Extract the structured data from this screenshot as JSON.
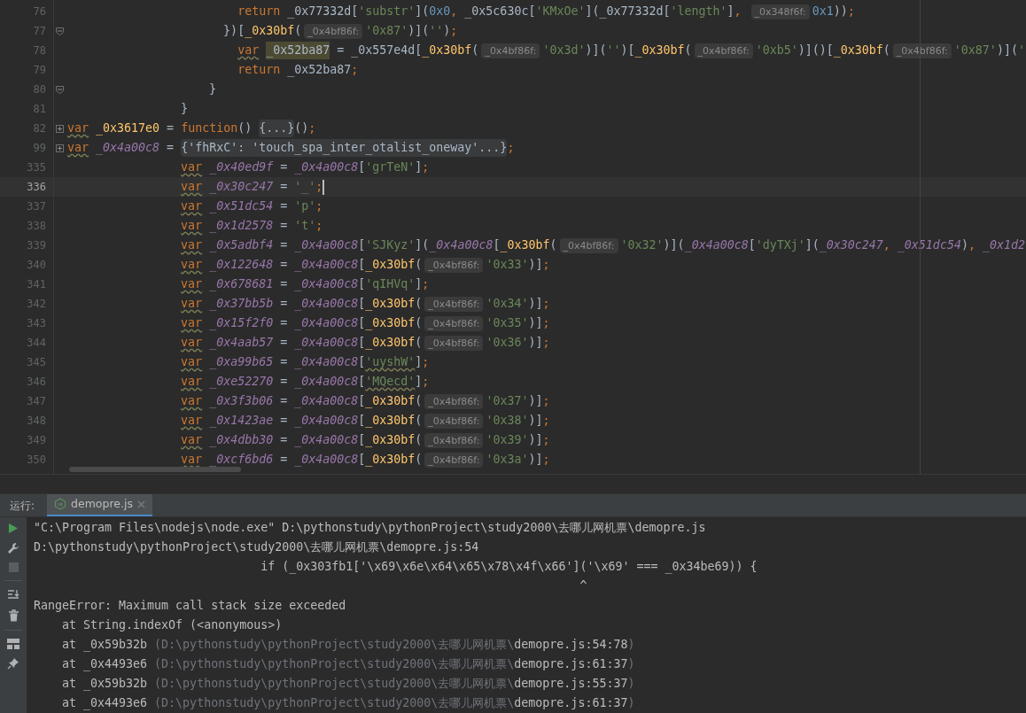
{
  "editor": {
    "lines": [
      {
        "number": "76",
        "current": false,
        "tokens": [
          {
            "kind": "kw",
            "text": "                        return"
          },
          {
            "kind": "plain",
            "text": " _0x77332d["
          },
          {
            "kind": "str",
            "text": "'substr'"
          },
          {
            "kind": "plain",
            "text": "]("
          },
          {
            "kind": "num",
            "text": "0x0"
          },
          {
            "kind": "punct",
            "text": ", "
          },
          {
            "kind": "plain",
            "text": "_0x5c630c["
          },
          {
            "kind": "str",
            "text": "'KMxOe'"
          },
          {
            "kind": "plain",
            "text": "](_0x77332d["
          },
          {
            "kind": "str",
            "text": "'length'"
          },
          {
            "kind": "plain",
            "text": "]"
          },
          {
            "kind": "punct",
            "text": ", "
          },
          {
            "kind": "hint",
            "text": "_0x348f6f:"
          },
          {
            "kind": "num",
            "text": "0x1"
          },
          {
            "kind": "plain",
            "text": "))"
          },
          {
            "kind": "punct",
            "text": ";"
          }
        ]
      },
      {
        "number": "77",
        "current": false,
        "collapsed": false,
        "tokens": [
          {
            "kind": "plain",
            "text": "                      })["
          },
          {
            "kind": "fn",
            "text": "_0x30bf"
          },
          {
            "kind": "plain",
            "text": "("
          },
          {
            "kind": "hint",
            "text": "_0x4bf86f:"
          },
          {
            "kind": "str",
            "text": "'0x87'"
          },
          {
            "kind": "plain",
            "text": ")]("
          },
          {
            "kind": "str",
            "text": "''"
          },
          {
            "kind": "plain",
            "text": ")"
          },
          {
            "kind": "punct",
            "text": ";"
          }
        ]
      },
      {
        "number": "78",
        "current": false,
        "tokens": [
          {
            "kind": "kwu",
            "text": "                        var"
          },
          {
            "kind": "match",
            "text": "_0x52ba87"
          },
          {
            "kind": "plain",
            "text": " = _0x557e4d["
          },
          {
            "kind": "fn",
            "text": "_0x30bf"
          },
          {
            "kind": "plain",
            "text": "("
          },
          {
            "kind": "hint",
            "text": "_0x4bf86f:"
          },
          {
            "kind": "str",
            "text": "'0x3d'"
          },
          {
            "kind": "plain",
            "text": ")]("
          },
          {
            "kind": "str",
            "text": "''"
          },
          {
            "kind": "plain",
            "text": ")["
          },
          {
            "kind": "fn",
            "text": "_0x30bf"
          },
          {
            "kind": "plain",
            "text": "("
          },
          {
            "kind": "hint",
            "text": "_0x4bf86f:"
          },
          {
            "kind": "str",
            "text": "'0xb5'"
          },
          {
            "kind": "plain",
            "text": ")]()["
          },
          {
            "kind": "fn",
            "text": "_0x30bf"
          },
          {
            "kind": "plain",
            "text": "("
          },
          {
            "kind": "hint",
            "text": "_0x4bf86f:"
          },
          {
            "kind": "str",
            "text": "'0x87'"
          },
          {
            "kind": "plain",
            "text": ")]("
          },
          {
            "kind": "str",
            "text": "'"
          }
        ]
      },
      {
        "number": "79",
        "current": false,
        "tokens": [
          {
            "kind": "kw",
            "text": "                        return"
          },
          {
            "kind": "plain",
            "text": " _0x52ba87"
          },
          {
            "kind": "punct",
            "text": ";"
          }
        ]
      },
      {
        "number": "80",
        "current": false,
        "collapsed": false,
        "tokens": [
          {
            "kind": "plain",
            "text": "                    }"
          }
        ]
      },
      {
        "number": "81",
        "current": false,
        "tokens": [
          {
            "kind": "plain",
            "text": "                }"
          }
        ]
      },
      {
        "number": "82",
        "current": false,
        "collapsed": true,
        "tokens": [
          {
            "kind": "kwu",
            "text": "var"
          },
          {
            "kind": "fn",
            "text": "_0x3617e0"
          },
          {
            "kind": "plain",
            "text": " = "
          },
          {
            "kind": "kw",
            "text": "function"
          },
          {
            "kind": "plain",
            "text": "() "
          },
          {
            "kind": "fold",
            "text": "{...}"
          },
          {
            "kind": "plain",
            "text": "()"
          },
          {
            "kind": "punct",
            "text": ";"
          }
        ]
      },
      {
        "number": "99",
        "current": false,
        "collapsed": true,
        "tokens": [
          {
            "kind": "kwu",
            "text": "var"
          },
          {
            "kind": "local",
            "text": "_0x4a00c8"
          },
          {
            "kind": "plain",
            "text": " = "
          },
          {
            "kind": "fold",
            "text": "{'fhRxC': 'touch_spa_inter_otalist_oneway'...}"
          },
          {
            "kind": "punct",
            "text": ";"
          }
        ]
      },
      {
        "number": "335",
        "current": false,
        "tokens": [
          {
            "kind": "kwu",
            "text": "                var"
          },
          {
            "kind": "local",
            "text": "_0x40ed9f"
          },
          {
            "kind": "plain",
            "text": " = "
          },
          {
            "kind": "local",
            "text": "_0x4a00c8"
          },
          {
            "kind": "plain",
            "text": "["
          },
          {
            "kind": "str",
            "text": "'grTeN'"
          },
          {
            "kind": "plain",
            "text": "]"
          },
          {
            "kind": "punct",
            "text": ";"
          }
        ]
      },
      {
        "number": "336",
        "current": true,
        "tokens": [
          {
            "kind": "kwu",
            "text": "                var"
          },
          {
            "kind": "local",
            "text": "_0x30c247"
          },
          {
            "kind": "plain",
            "text": " = "
          },
          {
            "kind": "str",
            "text": "'_'"
          },
          {
            "kind": "punct",
            "text": ";"
          }
        ]
      },
      {
        "number": "337",
        "current": false,
        "tokens": [
          {
            "kind": "kwu",
            "text": "                var"
          },
          {
            "kind": "local",
            "text": "_0x51dc54"
          },
          {
            "kind": "plain",
            "text": " = "
          },
          {
            "kind": "str",
            "text": "'p'"
          },
          {
            "kind": "punct",
            "text": ";"
          }
        ]
      },
      {
        "number": "338",
        "current": false,
        "tokens": [
          {
            "kind": "kwu",
            "text": "                var"
          },
          {
            "kind": "local",
            "text": "_0x1d2578"
          },
          {
            "kind": "plain",
            "text": " = "
          },
          {
            "kind": "str",
            "text": "'t'"
          },
          {
            "kind": "punct",
            "text": ";"
          }
        ]
      },
      {
        "number": "339",
        "current": false,
        "tokens": [
          {
            "kind": "kwu",
            "text": "                var"
          },
          {
            "kind": "local",
            "text": "_0x5adbf4"
          },
          {
            "kind": "plain",
            "text": " = "
          },
          {
            "kind": "local",
            "text": "_0x4a00c8"
          },
          {
            "kind": "plain",
            "text": "["
          },
          {
            "kind": "str",
            "text": "'SJKyz'"
          },
          {
            "kind": "plain",
            "text": "]("
          },
          {
            "kind": "local",
            "text": "_0x4a00c8"
          },
          {
            "kind": "plain",
            "text": "["
          },
          {
            "kind": "fn",
            "text": "_0x30bf"
          },
          {
            "kind": "plain",
            "text": "("
          },
          {
            "kind": "hint",
            "text": "_0x4bf86f:"
          },
          {
            "kind": "str",
            "text": "'0x32'"
          },
          {
            "kind": "plain",
            "text": ")]("
          },
          {
            "kind": "local",
            "text": "_0x4a00c8"
          },
          {
            "kind": "plain",
            "text": "["
          },
          {
            "kind": "str",
            "text": "'dyTXj'"
          },
          {
            "kind": "plain",
            "text": "]("
          },
          {
            "kind": "local",
            "text": "_0x30c247"
          },
          {
            "kind": "punct",
            "text": ", "
          },
          {
            "kind": "local",
            "text": "_0x51dc54"
          },
          {
            "kind": "plain",
            "text": ")"
          },
          {
            "kind": "punct",
            "text": ", "
          },
          {
            "kind": "local",
            "text": "_0x1d2"
          }
        ]
      },
      {
        "number": "340",
        "current": false,
        "tokens": [
          {
            "kind": "kwu",
            "text": "                var"
          },
          {
            "kind": "local",
            "text": "_0x122648"
          },
          {
            "kind": "plain",
            "text": " = "
          },
          {
            "kind": "local",
            "text": "_0x4a00c8"
          },
          {
            "kind": "plain",
            "text": "["
          },
          {
            "kind": "fn",
            "text": "_0x30bf"
          },
          {
            "kind": "plain",
            "text": "("
          },
          {
            "kind": "hint",
            "text": "_0x4bf86f:"
          },
          {
            "kind": "str",
            "text": "'0x33'"
          },
          {
            "kind": "plain",
            "text": ")]"
          },
          {
            "kind": "punct",
            "text": ";"
          }
        ]
      },
      {
        "number": "341",
        "current": false,
        "tokens": [
          {
            "kind": "kwu",
            "text": "                var"
          },
          {
            "kind": "local",
            "text": "_0x678681"
          },
          {
            "kind": "plain",
            "text": " = "
          },
          {
            "kind": "local",
            "text": "_0x4a00c8"
          },
          {
            "kind": "plain",
            "text": "["
          },
          {
            "kind": "str",
            "text": "'qIHVq'"
          },
          {
            "kind": "plain",
            "text": "]"
          },
          {
            "kind": "punct",
            "text": ";"
          }
        ]
      },
      {
        "number": "342",
        "current": false,
        "tokens": [
          {
            "kind": "kwu",
            "text": "                var"
          },
          {
            "kind": "local",
            "text": "_0x37bb5b"
          },
          {
            "kind": "plain",
            "text": " = "
          },
          {
            "kind": "local",
            "text": "_0x4a00c8"
          },
          {
            "kind": "plain",
            "text": "["
          },
          {
            "kind": "fn",
            "text": "_0x30bf"
          },
          {
            "kind": "plain",
            "text": "("
          },
          {
            "kind": "hint",
            "text": "_0x4bf86f:"
          },
          {
            "kind": "str",
            "text": "'0x34'"
          },
          {
            "kind": "plain",
            "text": ")]"
          },
          {
            "kind": "punct",
            "text": ";"
          }
        ]
      },
      {
        "number": "343",
        "current": false,
        "tokens": [
          {
            "kind": "kwu",
            "text": "                var"
          },
          {
            "kind": "local",
            "text": "_0x15f2f0"
          },
          {
            "kind": "plain",
            "text": " = "
          },
          {
            "kind": "local",
            "text": "_0x4a00c8"
          },
          {
            "kind": "plain",
            "text": "["
          },
          {
            "kind": "fn",
            "text": "_0x30bf"
          },
          {
            "kind": "plain",
            "text": "("
          },
          {
            "kind": "hint",
            "text": "_0x4bf86f:"
          },
          {
            "kind": "str",
            "text": "'0x35'"
          },
          {
            "kind": "plain",
            "text": ")]"
          },
          {
            "kind": "punct",
            "text": ";"
          }
        ]
      },
      {
        "number": "344",
        "current": false,
        "tokens": [
          {
            "kind": "kwu",
            "text": "                var"
          },
          {
            "kind": "local",
            "text": "_0x4aab57"
          },
          {
            "kind": "plain",
            "text": " = "
          },
          {
            "kind": "local",
            "text": "_0x4a00c8"
          },
          {
            "kind": "plain",
            "text": "["
          },
          {
            "kind": "fn",
            "text": "_0x30bf"
          },
          {
            "kind": "plain",
            "text": "("
          },
          {
            "kind": "hint",
            "text": "_0x4bf86f:"
          },
          {
            "kind": "str",
            "text": "'0x36'"
          },
          {
            "kind": "plain",
            "text": ")]"
          },
          {
            "kind": "punct",
            "text": ";"
          }
        ]
      },
      {
        "number": "345",
        "current": false,
        "tokens": [
          {
            "kind": "kwu",
            "text": "                var"
          },
          {
            "kind": "local",
            "text": "_0xa99b65"
          },
          {
            "kind": "plain",
            "text": " = "
          },
          {
            "kind": "local",
            "text": "_0x4a00c8"
          },
          {
            "kind": "plain",
            "text": "["
          },
          {
            "kind": "stru",
            "text": "'uyshW'"
          },
          {
            "kind": "plain",
            "text": "]"
          },
          {
            "kind": "punct",
            "text": ";"
          }
        ]
      },
      {
        "number": "346",
        "current": false,
        "tokens": [
          {
            "kind": "kwu",
            "text": "                var"
          },
          {
            "kind": "local",
            "text": "_0xe52270"
          },
          {
            "kind": "plain",
            "text": " = "
          },
          {
            "kind": "local",
            "text": "_0x4a00c8"
          },
          {
            "kind": "plain",
            "text": "["
          },
          {
            "kind": "stru",
            "text": "'MQecd'"
          },
          {
            "kind": "plain",
            "text": "]"
          },
          {
            "kind": "punct",
            "text": ";"
          }
        ]
      },
      {
        "number": "347",
        "current": false,
        "tokens": [
          {
            "kind": "kwu",
            "text": "                var"
          },
          {
            "kind": "local",
            "text": "_0x3f3b06"
          },
          {
            "kind": "plain",
            "text": " = "
          },
          {
            "kind": "local",
            "text": "_0x4a00c8"
          },
          {
            "kind": "plain",
            "text": "["
          },
          {
            "kind": "fn",
            "text": "_0x30bf"
          },
          {
            "kind": "plain",
            "text": "("
          },
          {
            "kind": "hint",
            "text": "_0x4bf86f:"
          },
          {
            "kind": "str",
            "text": "'0x37'"
          },
          {
            "kind": "plain",
            "text": ")]"
          },
          {
            "kind": "punct",
            "text": ";"
          }
        ]
      },
      {
        "number": "348",
        "current": false,
        "tokens": [
          {
            "kind": "kwu",
            "text": "                var"
          },
          {
            "kind": "local",
            "text": "_0x1423ae"
          },
          {
            "kind": "plain",
            "text": " = "
          },
          {
            "kind": "local",
            "text": "_0x4a00c8"
          },
          {
            "kind": "plain",
            "text": "["
          },
          {
            "kind": "fn",
            "text": "_0x30bf"
          },
          {
            "kind": "plain",
            "text": "("
          },
          {
            "kind": "hint",
            "text": "_0x4bf86f:"
          },
          {
            "kind": "str",
            "text": "'0x38'"
          },
          {
            "kind": "plain",
            "text": ")]"
          },
          {
            "kind": "punct",
            "text": ";"
          }
        ]
      },
      {
        "number": "349",
        "current": false,
        "tokens": [
          {
            "kind": "kwu",
            "text": "                var"
          },
          {
            "kind": "local",
            "text": "_0x4dbb30"
          },
          {
            "kind": "plain",
            "text": " = "
          },
          {
            "kind": "local",
            "text": "_0x4a00c8"
          },
          {
            "kind": "plain",
            "text": "["
          },
          {
            "kind": "fn",
            "text": "_0x30bf"
          },
          {
            "kind": "plain",
            "text": "("
          },
          {
            "kind": "hint",
            "text": "_0x4bf86f:"
          },
          {
            "kind": "str",
            "text": "'0x39'"
          },
          {
            "kind": "plain",
            "text": ")]"
          },
          {
            "kind": "punct",
            "text": ";"
          }
        ]
      },
      {
        "number": "350",
        "current": false,
        "tokens": [
          {
            "kind": "kwu",
            "text": "                var"
          },
          {
            "kind": "local",
            "text": "_0xcf6bd6"
          },
          {
            "kind": "plain",
            "text": " = "
          },
          {
            "kind": "local",
            "text": "_0x4a00c8"
          },
          {
            "kind": "plain",
            "text": "["
          },
          {
            "kind": "fn",
            "text": "_0x30bf"
          },
          {
            "kind": "plain",
            "text": "("
          },
          {
            "kind": "hint",
            "text": "_0x4bf86f:"
          },
          {
            "kind": "str",
            "text": "'0x3a'"
          },
          {
            "kind": "plain",
            "text": ")]"
          },
          {
            "kind": "punct",
            "text": ";"
          }
        ]
      }
    ]
  },
  "run_panel": {
    "label": "运行:",
    "tabs": [
      {
        "label": "demopre.js",
        "selected": true
      }
    ],
    "output": [
      [
        {
          "kind": "plain",
          "text": "\"C:\\Program Files\\nodejs\\node.exe\" D:\\pythonstudy\\pythonProject\\study2000\\去哪儿网机票\\demopre.js"
        }
      ],
      [
        {
          "kind": "plain",
          "text": "D:\\pythonstudy\\pythonProject\\study2000\\去哪儿网机票\\demopre.js:54"
        }
      ],
      [
        {
          "kind": "plain",
          "text": "                                if (_0x303fb1['\\x69\\x6e\\x64\\x65\\x78\\x4f\\x66']('\\x69' === _0x34be69)) {"
        }
      ],
      [
        {
          "kind": "plain",
          "text": "                                                                             ^"
        }
      ],
      [
        {
          "kind": "plain",
          "text": "RangeError: Maximum call stack size exceeded"
        }
      ],
      [
        {
          "kind": "plain",
          "text": "    at String.indexOf (<anonymous>)"
        }
      ],
      [
        {
          "kind": "plain",
          "text": "    at _0x59b32b "
        },
        {
          "kind": "dim",
          "text": "(D:\\pythonstudy\\pythonProject\\study2000\\去哪儿网机票\\"
        },
        {
          "kind": "plain",
          "text": "demopre.js:54:78"
        },
        {
          "kind": "dim",
          "text": ")"
        }
      ],
      [
        {
          "kind": "plain",
          "text": "    at _0x4493e6 "
        },
        {
          "kind": "dim",
          "text": "(D:\\pythonstudy\\pythonProject\\study2000\\去哪儿网机票\\"
        },
        {
          "kind": "plain",
          "text": "demopre.js:61:37"
        },
        {
          "kind": "dim",
          "text": ")"
        }
      ],
      [
        {
          "kind": "plain",
          "text": "    at _0x59b32b "
        },
        {
          "kind": "dim",
          "text": "(D:\\pythonstudy\\pythonProject\\study2000\\去哪儿网机票\\"
        },
        {
          "kind": "plain",
          "text": "demopre.js:55:37"
        },
        {
          "kind": "dim",
          "text": ")"
        }
      ],
      [
        {
          "kind": "plain",
          "text": "    at _0x4493e6 "
        },
        {
          "kind": "dim",
          "text": "(D:\\pythonstudy\\pythonProject\\study2000\\去哪儿网机票\\"
        },
        {
          "kind": "plain",
          "text": "demopre.js:61:37"
        },
        {
          "kind": "dim",
          "text": ")"
        }
      ]
    ]
  }
}
